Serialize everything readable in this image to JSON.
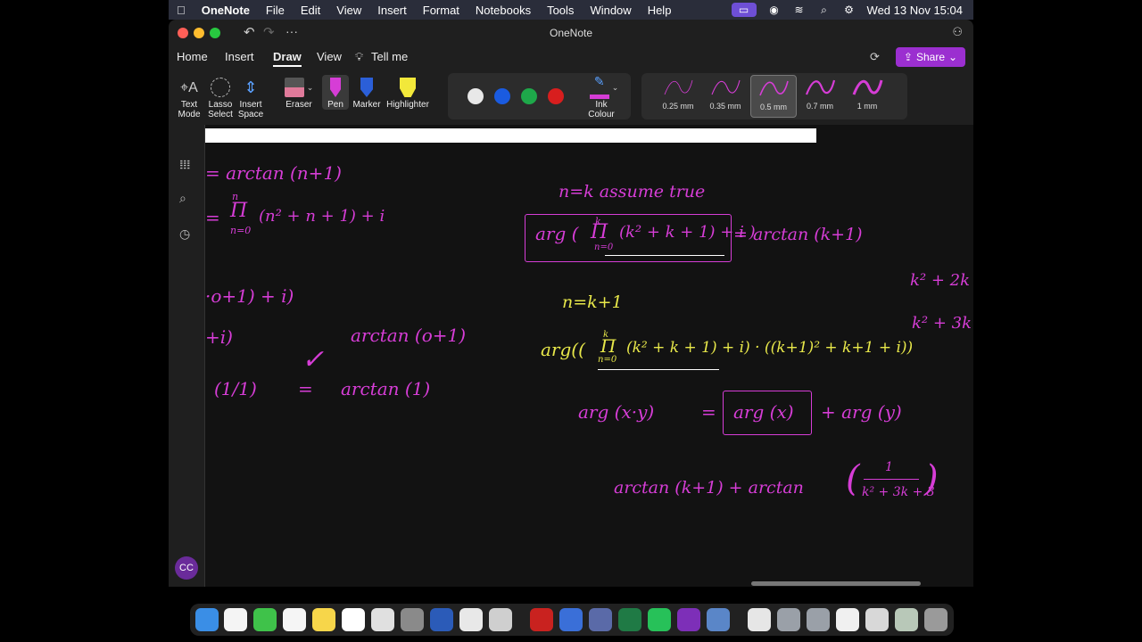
{
  "menubar": {
    "app": "OneNote",
    "items": [
      "File",
      "Edit",
      "View",
      "Insert",
      "Format",
      "Notebooks",
      "Tools",
      "Window",
      "Help"
    ],
    "clock": "Wed 13 Nov  15:04"
  },
  "window": {
    "title": "OneNote",
    "tabs": [
      "Home",
      "Insert",
      "Draw",
      "View"
    ],
    "active_tab": "Draw",
    "tell_me": "Tell me",
    "share": "Share"
  },
  "tools": {
    "text_mode": "Text Mode",
    "lasso_select": "Lasso Select",
    "insert_space": "Insert Space",
    "eraser": "Eraser",
    "pen": "Pen",
    "marker": "Marker",
    "highlighter": "Highlighter",
    "ink_colour": "Ink Colour",
    "colors": [
      "#e8e8e8",
      "#1a5be0",
      "#1ea84a",
      "#d81e1e"
    ],
    "stroke_sizes": [
      "0.25 mm",
      "0.35 mm",
      "0.5 mm",
      "0.7 mm",
      "1 mm"
    ],
    "selected_size": "0.5 mm"
  },
  "sidebar": {
    "avatar": "CC"
  },
  "ink": {
    "l1": "= arctan (n+1)",
    "l2_prod": "Π",
    "l2_top": "n",
    "l2_bot": "n=0",
    "l2_rest": "(n² + n + 1) + i",
    "l3": "·o+1) + i)",
    "l4": "+i)",
    "l5a": "(1/1)",
    "l5b": "arctan (1)",
    "l4b": "arctan (o+1)",
    "check": "✓",
    "eq": "=",
    "r1": "n=k   assume true",
    "r2a": "arg (",
    "r2_prod": "Π",
    "r2_top": "k",
    "r2_bot": "n=0",
    "r2b": "(k² + k + 1) + i )",
    "r2c": "= arctan (k+1)",
    "r3": "n=k+1",
    "r4a": "arg((",
    "r4_prod": "Π",
    "r4_top": "k",
    "r4_bot": "n=0",
    "r4b": "(k² + k + 1) + i) · ((k+1)² + k+1 + i))",
    "r5a": "arg (x·y)",
    "r5eq": "=",
    "r5b": "arg (x)",
    "r5c": "+ arg (y)",
    "r6a": "arctan (k+1)  +  arctan",
    "r6num": "1",
    "r6den": "k² + 3k + 3",
    "f1": "k² + 2k",
    "f2": "k² + 3k"
  }
}
